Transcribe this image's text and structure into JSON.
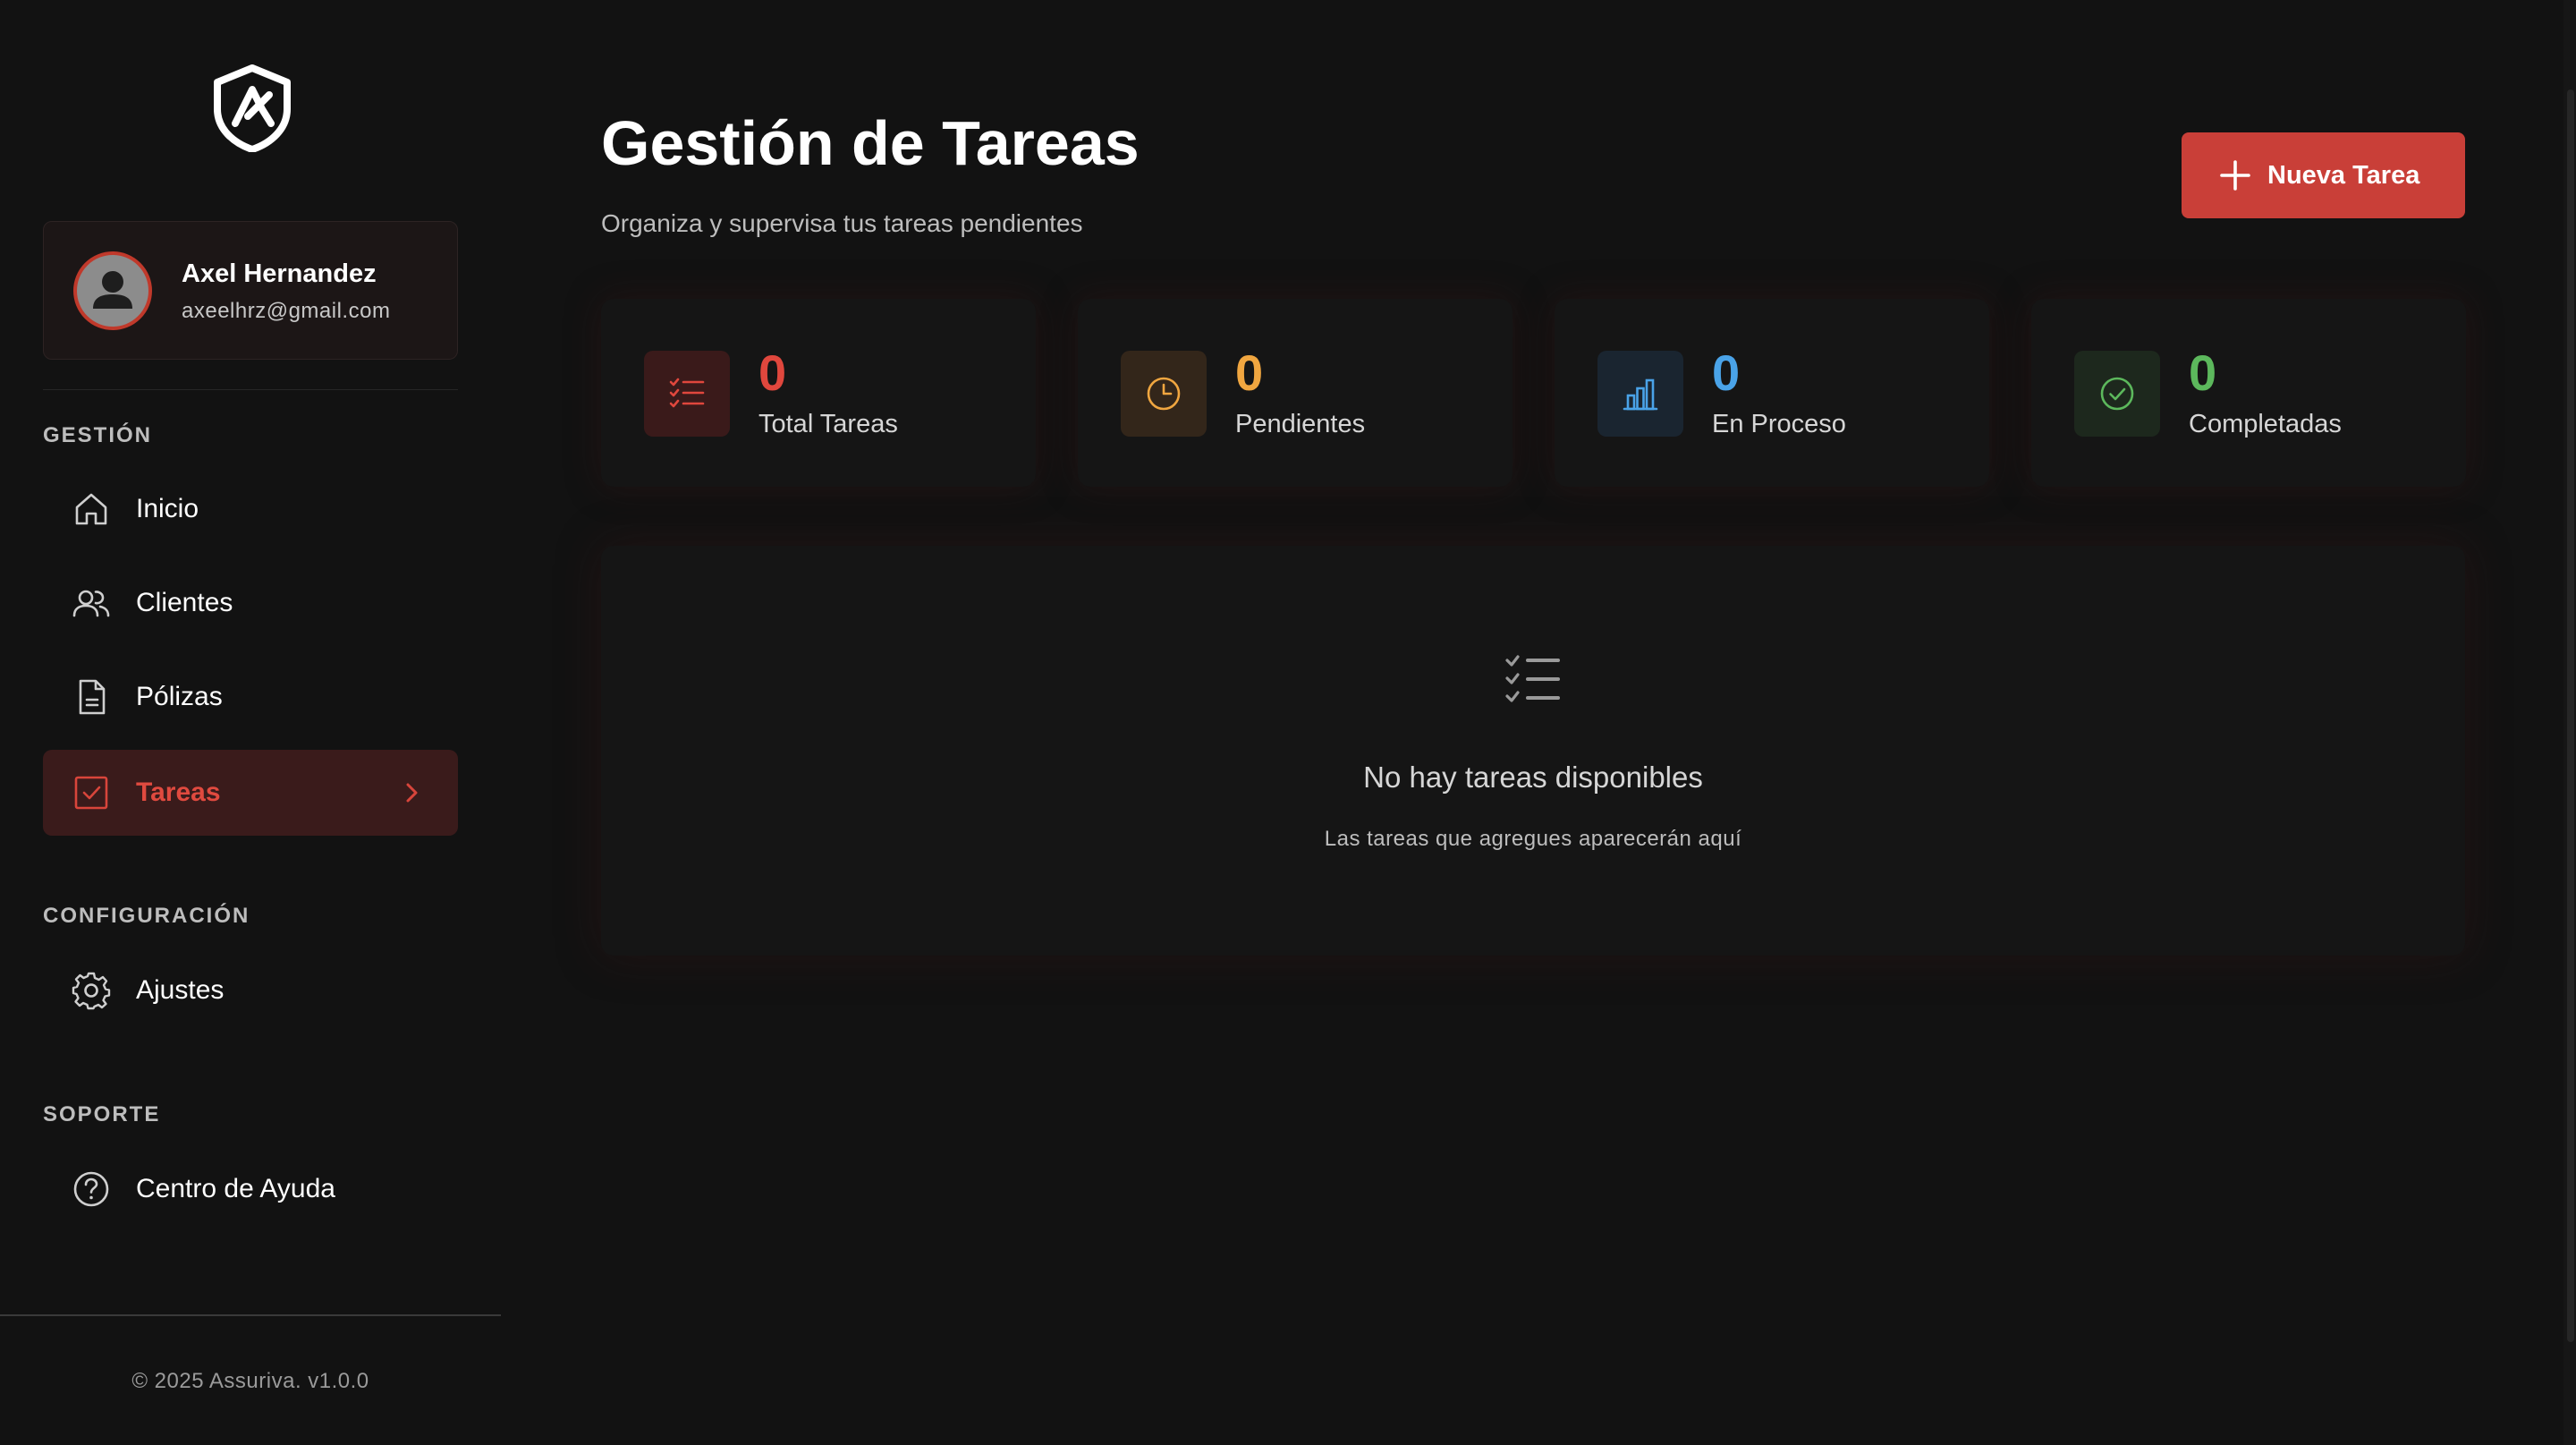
{
  "sidebar": {
    "user": {
      "name": "Axel Hernandez",
      "email": "axeelhrz@gmail.com"
    },
    "sections": {
      "gestion": "GESTIÓN",
      "configuracion": "CONFIGURACIÓN",
      "soporte": "SOPORTE"
    },
    "items": [
      {
        "label": "Inicio",
        "icon": "home-icon"
      },
      {
        "label": "Clientes",
        "icon": "users-icon"
      },
      {
        "label": "Pólizas",
        "icon": "document-icon"
      },
      {
        "label": "Tareas",
        "icon": "checkbox-icon",
        "active": true
      },
      {
        "label": "Ajustes",
        "icon": "gear-icon"
      },
      {
        "label": "Centro de Ayuda",
        "icon": "help-icon"
      }
    ],
    "copyright": "© 2025 Assuriva. v1.0.0"
  },
  "header": {
    "title": "Gestión de Tareas",
    "subtitle": "Organiza y supervisa tus tareas pendientes",
    "new_button_label": "Nueva Tarea"
  },
  "stats": [
    {
      "value": "0",
      "label": "Total Tareas",
      "color": "#e0473d",
      "icon": "task-list-icon"
    },
    {
      "value": "0",
      "label": "Pendientes",
      "color": "#f0a640",
      "icon": "clock-icon"
    },
    {
      "value": "0",
      "label": "En Proceso",
      "color": "#4aa3e8",
      "icon": "bar-chart-icon"
    },
    {
      "value": "0",
      "label": "Completadas",
      "color": "#5cb85c",
      "icon": "check-circle-icon"
    }
  ],
  "empty_state": {
    "title": "No hay tareas disponibles",
    "subtitle": "Las tareas que agregues aparecerán aquí"
  },
  "colors": {
    "accent": "#c93f38",
    "background": "#121212"
  }
}
